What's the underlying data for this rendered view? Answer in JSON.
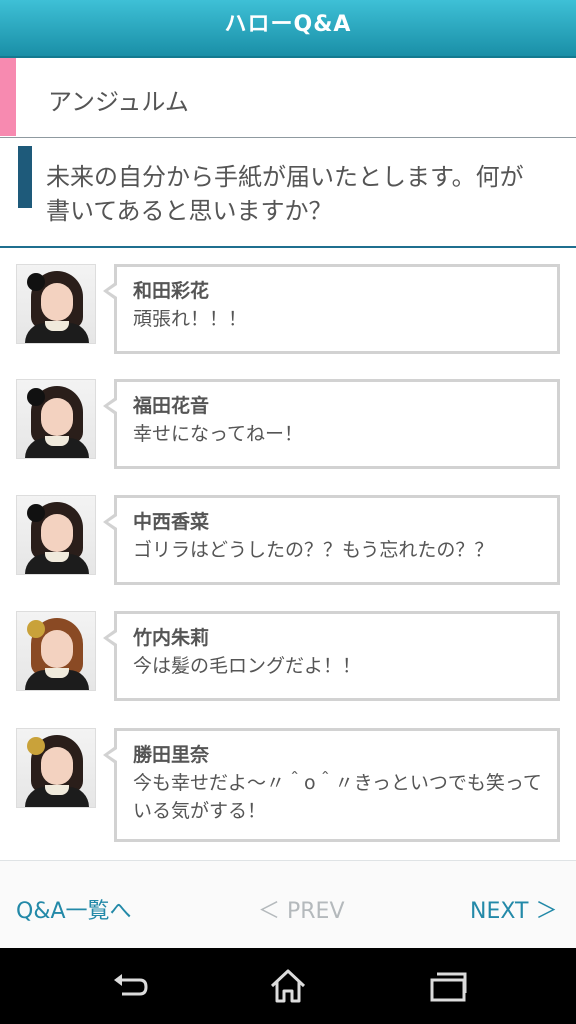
{
  "header": {
    "title": "ハローQ&A"
  },
  "group": {
    "name": "アンジュルム"
  },
  "question": {
    "text": "未来の自分から手紙が届いたとします。何が書いてあると思いますか？"
  },
  "answers": [
    {
      "name": "和田彩花",
      "text": "頑張れ！！！"
    },
    {
      "name": "福田花音",
      "text": "幸せになってねー！"
    },
    {
      "name": "中西香菜",
      "text": "ゴリラはどうしたの？？もう忘れたの？？"
    },
    {
      "name": "竹内朱莉",
      "text": "今は髪の毛ロングだよ！！"
    },
    {
      "name": "勝田里奈",
      "text": "今も幸せだよ～〃＾o＾〃きっといつでも笑っている気がする！"
    }
  ],
  "footer": {
    "list_label": "Q&A一覧へ",
    "prev_label": "＜ PREV",
    "next_label": "NEXT ＞"
  },
  "system_nav": {
    "back_icon": "back-icon",
    "home_icon": "home-icon",
    "recent_icon": "recent-apps-icon"
  },
  "colors": {
    "header": "#1f9db6",
    "group_accent": "#f78ab0",
    "question_accent": "#1e5a7a",
    "link": "#2389a8",
    "disabled": "#b4b9bc"
  }
}
